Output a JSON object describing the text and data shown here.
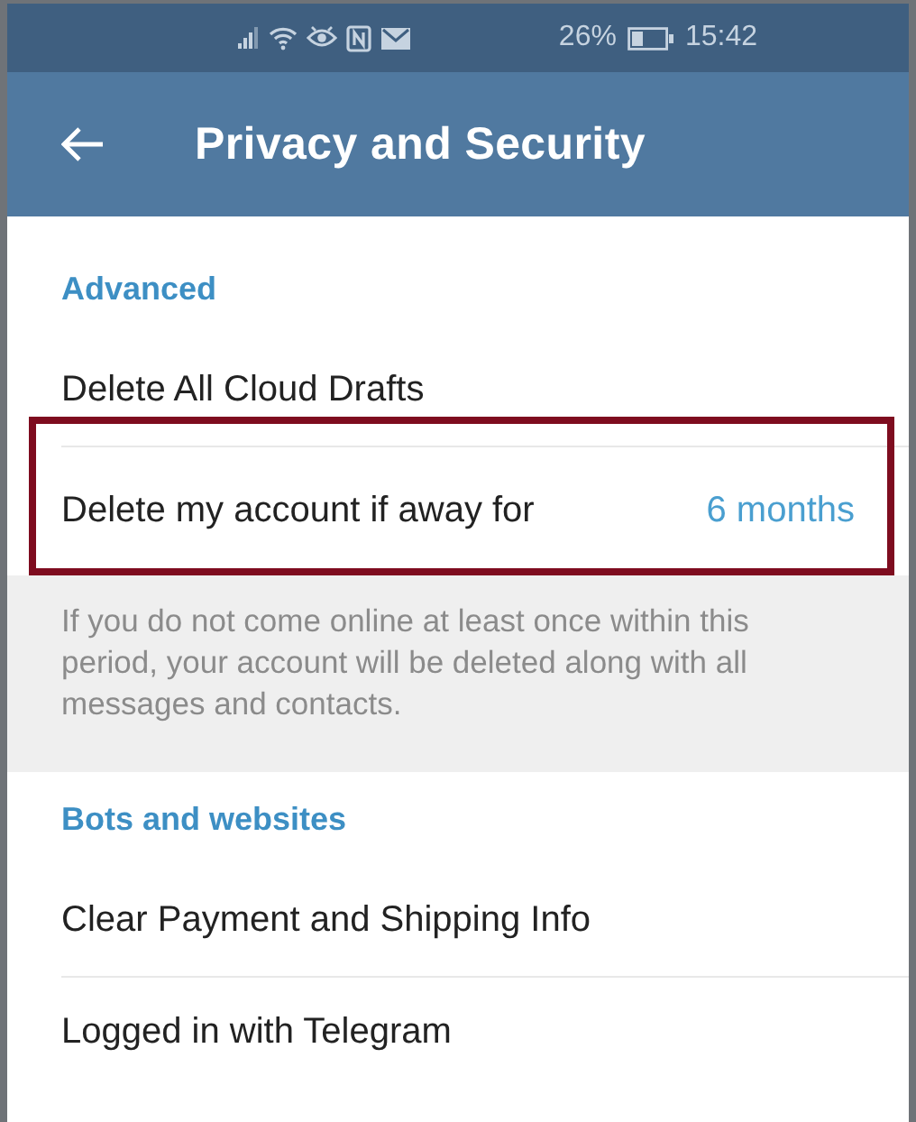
{
  "status_bar": {
    "battery_percent": "26%",
    "time": "15:42"
  },
  "header": {
    "title": "Privacy and Security"
  },
  "sections": [
    {
      "title": "Advanced",
      "items": [
        {
          "label": "Delete All Cloud Drafts",
          "highlighted": false
        },
        {
          "label": "Delete my account if away for",
          "value": "6 months",
          "highlighted": true
        }
      ],
      "footer": "If you do not come online at least once within this period, your account will be deleted along with all messages and contacts."
    },
    {
      "title": "Bots and websites",
      "items": [
        {
          "label": "Clear Payment and Shipping Info",
          "highlighted": false
        },
        {
          "label": "Logged in with Telegram",
          "highlighted": false
        }
      ]
    }
  ]
}
